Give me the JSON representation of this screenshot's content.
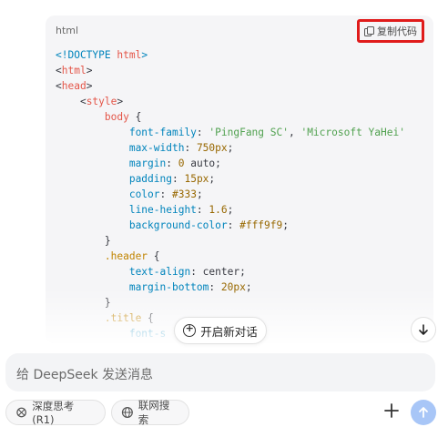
{
  "code_block": {
    "language": "html",
    "copy_label": "复制代码",
    "lines": [
      "<!DOCTYPE html>",
      "<html>",
      "<head>",
      "    <style>",
      "        body {",
      "            font-family: 'PingFang SC', 'Microsoft YaHei'",
      "            max-width: 750px;",
      "            margin: 0 auto;",
      "            padding: 15px;",
      "            color: #333;",
      "            line-height: 1.6;",
      "            background-color: #fff9f9;",
      "        }",
      "        .header {",
      "            text-align: center;",
      "            margin-bottom: 20px;",
      "        }",
      "        .title {",
      "            font-s"
    ]
  },
  "new_chat_label": "开启新对话",
  "input": {
    "placeholder": "给 DeepSeek 发送消息"
  },
  "chips": {
    "deep_think": "深度思考 (R1)",
    "web_search": "联网搜索"
  },
  "colors": {
    "copy_highlight": "#e01b1b",
    "send_button": "#a8c6f7"
  },
  "icons": [
    "copy-icon",
    "new-chat-icon",
    "arrow-down-icon",
    "deep-think-icon",
    "globe-icon",
    "plus-icon",
    "arrow-up-icon"
  ]
}
